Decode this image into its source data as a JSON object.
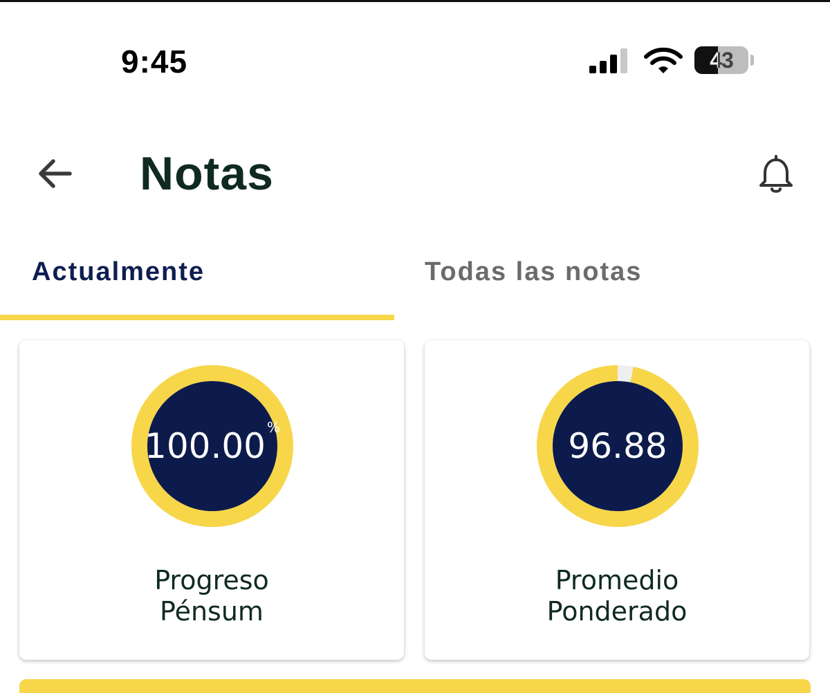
{
  "status_bar": {
    "time": "9:45",
    "battery_level": "43"
  },
  "header": {
    "title": "Notas",
    "back_icon": "arrow-left-icon",
    "notification_icon": "bell-icon"
  },
  "tabs": [
    {
      "label": "Actualmente",
      "active": true
    },
    {
      "label": "Todas las notas",
      "active": false
    }
  ],
  "cards": [
    {
      "value": "100.00",
      "unit": "%",
      "progress_fraction": 1.0,
      "label_line1": "Progreso",
      "label_line2": "Pénsum"
    },
    {
      "value": "96.88",
      "progress_fraction": 0.9688,
      "label_line1": "Promedio",
      "label_line2": "Ponderado"
    }
  ],
  "colors": {
    "accent": "#f7d64a",
    "navy": "#0c1b4c",
    "title": "#102a22"
  }
}
